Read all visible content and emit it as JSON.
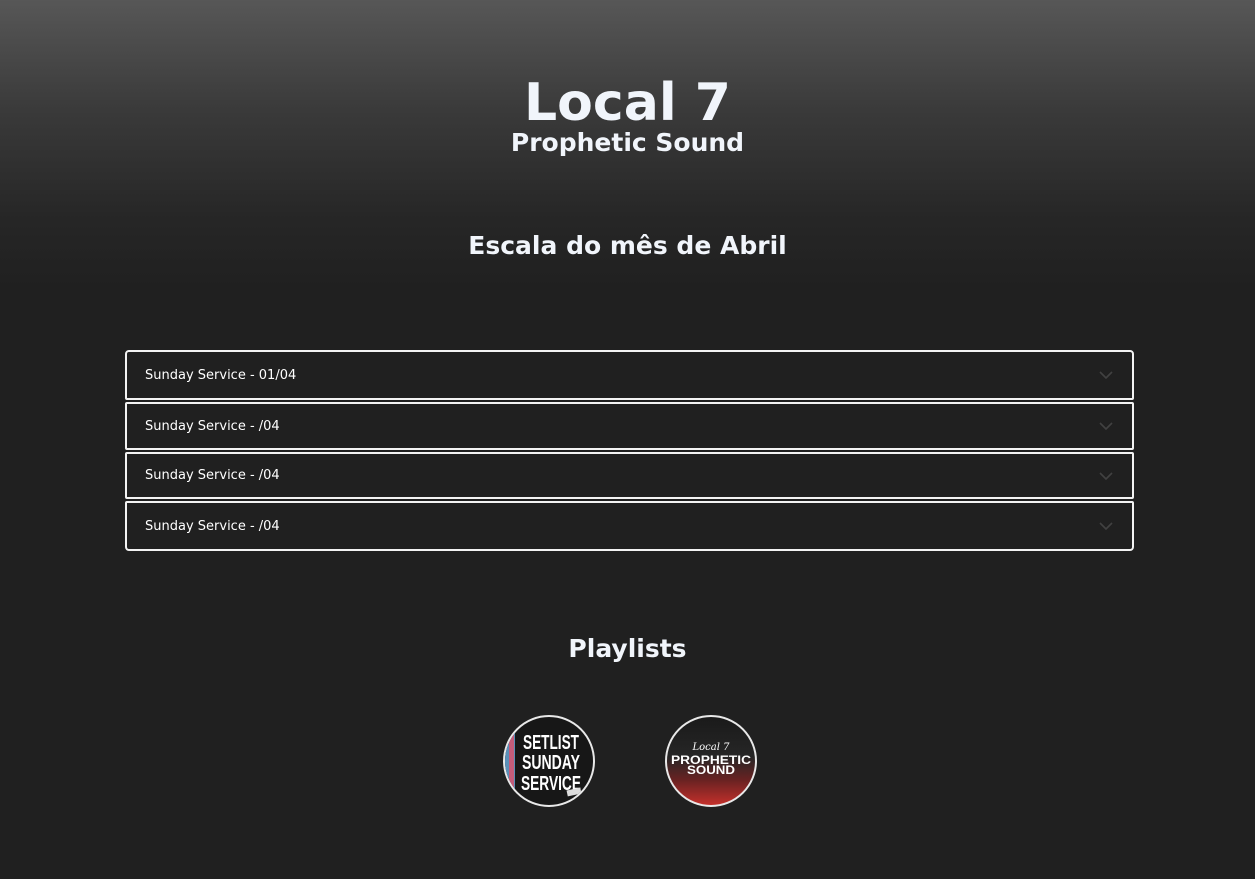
{
  "header": {
    "title": "Local 7",
    "subtitle": "Prophetic Sound"
  },
  "schedule": {
    "heading": "Escala do mês de Abril",
    "items": [
      {
        "label": "Sunday Service - 01/04"
      },
      {
        "label": "Sunday Service - /04"
      },
      {
        "label": "Sunday Service - /04"
      },
      {
        "label": "Sunday Service - /04"
      }
    ],
    "expand_icon": "chevron-down-icon"
  },
  "playlists": {
    "heading": "Playlists",
    "items": [
      {
        "cover_text": [
          "SETLIST",
          "SUNDAY",
          "SERVICE"
        ]
      },
      {
        "cover_text": [
          "Local 7",
          "PROPHETIC",
          "SOUND"
        ]
      }
    ]
  },
  "colors": {
    "background": "#202020",
    "text": "#f1f5fb",
    "border": "#f3f3f3",
    "accent_red": "#c4302b"
  }
}
